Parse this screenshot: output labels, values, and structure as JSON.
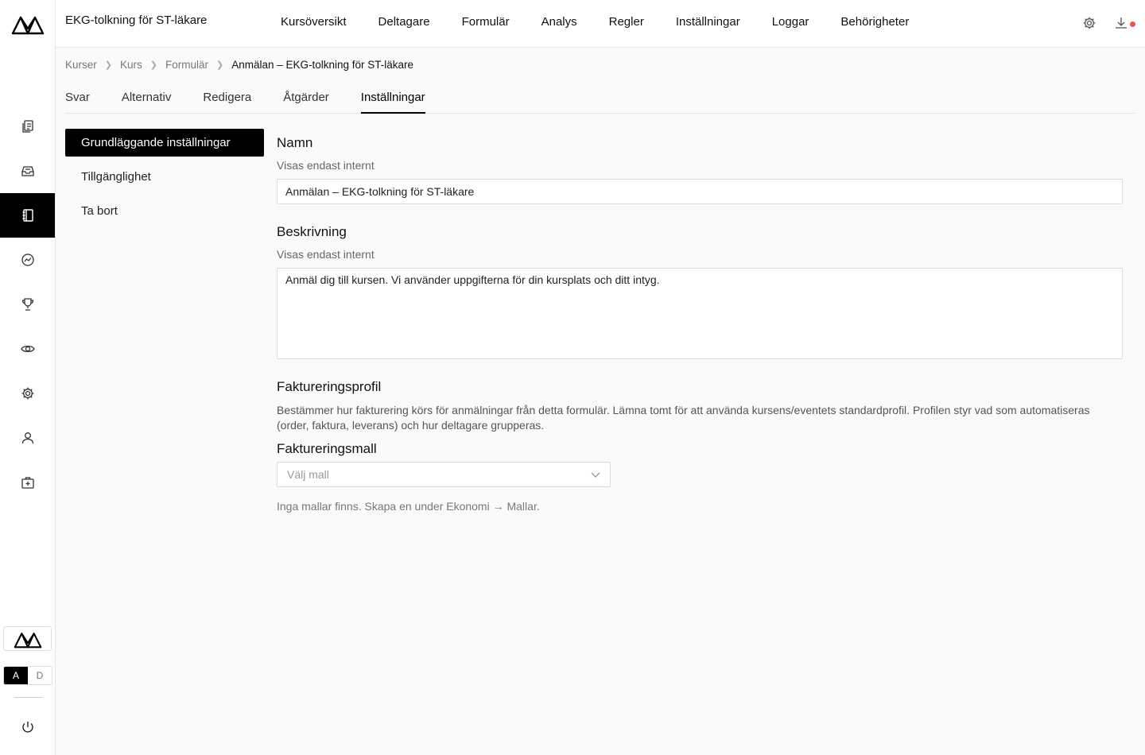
{
  "app": {
    "title": "EKG-tolkning för ST-läkare"
  },
  "topnav": [
    {
      "label": "Kursöversikt"
    },
    {
      "label": "Deltagare"
    },
    {
      "label": "Formulär"
    },
    {
      "label": "Analys"
    },
    {
      "label": "Regler"
    },
    {
      "label": "Inställningar"
    },
    {
      "label": "Loggar"
    },
    {
      "label": "Behörigheter"
    }
  ],
  "top_icons": {
    "settings": "gear-icon",
    "download": "download-icon",
    "notification_color": "#e55353"
  },
  "rail": {
    "items": [
      {
        "icon": "documents-icon"
      },
      {
        "icon": "inbox-icon"
      },
      {
        "icon": "notebook-icon",
        "active": true
      },
      {
        "icon": "chart-circle-icon"
      },
      {
        "icon": "trophy-icon"
      },
      {
        "icon": "eye-icon"
      },
      {
        "icon": "gear-icon"
      },
      {
        "icon": "user-icon"
      },
      {
        "icon": "medical-case-icon"
      }
    ],
    "lang": {
      "active": "A",
      "inactive": "D"
    }
  },
  "breadcrumb": [
    "Kurser",
    "Kurs",
    "Formulär",
    "Anmälan – EKG-tolkning för ST-läkare"
  ],
  "tabs": [
    {
      "label": "Svar"
    },
    {
      "label": "Alternativ"
    },
    {
      "label": "Redigera"
    },
    {
      "label": "Åtgärder"
    },
    {
      "label": "Inställningar",
      "active": true
    }
  ],
  "submenu": [
    {
      "label": "Grundläggande inställningar",
      "active": true
    },
    {
      "label": "Tillgänglighet"
    },
    {
      "label": "Ta bort"
    }
  ],
  "form": {
    "name": {
      "title": "Namn",
      "sub": "Visas endast internt",
      "value": "Anmälan – EKG-tolkning för ST-läkare"
    },
    "description": {
      "title": "Beskrivning",
      "sub": "Visas endast internt",
      "value": "Anmäl dig till kursen. Vi använder uppgifterna för din kursplats och ditt intyg."
    },
    "billing": {
      "title": "Faktureringsprofil",
      "desc": "Bestämmer hur fakturering körs för anmälningar från detta formulär. Lämna tomt för att använda kursens/eventets standardprofil. Profilen styr vad som automatiseras (order, faktura, leverans) och hur deltagare grupperas.",
      "template_label": "Faktureringsmall",
      "template_placeholder": "Välj mall",
      "hint": "Inga mallar finns. Skapa en under Ekonomi → Mallar."
    }
  },
  "colors": {
    "accent": "#000000",
    "border": "#dcdcdc",
    "muted": "#666666"
  }
}
